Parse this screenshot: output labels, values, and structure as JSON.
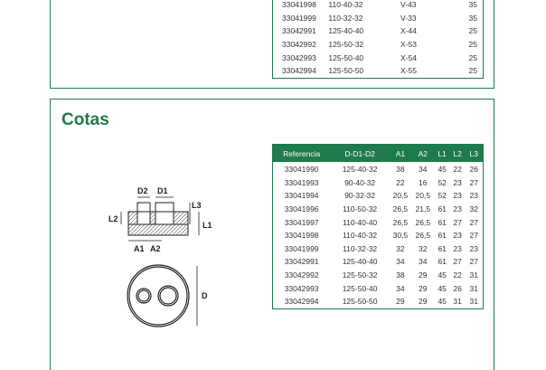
{
  "top_table": {
    "rows": [
      [
        "33041998",
        "110-40-32",
        "V-43",
        "35"
      ],
      [
        "33041999",
        "110-32-32",
        "V-33",
        "35"
      ],
      [
        "33042991",
        "125-40-40",
        "X-44",
        "25"
      ],
      [
        "33042992",
        "125-50-32",
        "X-53",
        "25"
      ],
      [
        "33042993",
        "125-50-40",
        "X-54",
        "25"
      ],
      [
        "33042994",
        "125-50-50",
        "X-55",
        "25"
      ]
    ]
  },
  "cotas": {
    "title": "Cotas",
    "headers": [
      "Referencia",
      "D-D1-D2",
      "A1",
      "A2",
      "L1",
      "L2",
      "L3"
    ],
    "rows": [
      [
        "33041990",
        "125-40-32",
        "38",
        "34",
        "45",
        "22",
        "26"
      ],
      [
        "33041993",
        "90-40-32",
        "22",
        "16",
        "52",
        "23",
        "27"
      ],
      [
        "33041994",
        "90-32-32",
        "20,5",
        "20,5",
        "52",
        "23",
        "23"
      ],
      [
        "33041996",
        "110-50-32",
        "26,5",
        "21,5",
        "61",
        "23",
        "32"
      ],
      [
        "33041997",
        "110-40-40",
        "26,5",
        "26,5",
        "61",
        "27",
        "27"
      ],
      [
        "33041998",
        "110-40-32",
        "30,5",
        "26,5",
        "61",
        "23",
        "27"
      ],
      [
        "33041999",
        "110-32-32",
        "32",
        "32",
        "61",
        "23",
        "23"
      ],
      [
        "33042991",
        "125-40-40",
        "34",
        "34",
        "61",
        "27",
        "27"
      ],
      [
        "33042992",
        "125-50-32",
        "38",
        "29",
        "45",
        "22",
        "31"
      ],
      [
        "33042993",
        "125-50-40",
        "34",
        "29",
        "45",
        "26",
        "31"
      ],
      [
        "33042994",
        "125-50-50",
        "29",
        "29",
        "45",
        "31",
        "31"
      ]
    ]
  },
  "drawing": {
    "labels": {
      "d2": "D2",
      "d1": "D1",
      "l3": "L3",
      "l2": "L2",
      "l1": "L1",
      "a1": "A1",
      "a2": "A2",
      "d": "D"
    }
  },
  "colors": {
    "brand_green": "#1f7a4c"
  }
}
